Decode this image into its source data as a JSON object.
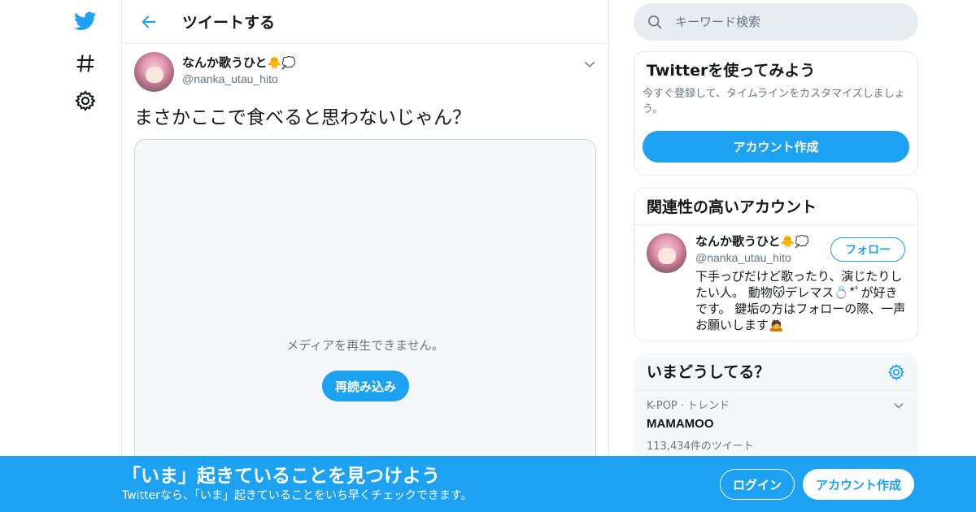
{
  "nav": {
    "icons": [
      "twitter-bird-icon",
      "hashtag-icon",
      "gear-icon"
    ]
  },
  "header": {
    "title": "ツイートする"
  },
  "tweet": {
    "author_name": "なんか歌うひと",
    "author_emoji": "🐥💭",
    "author_handle": "@nanka_utau_hito",
    "text": "まさかここで食べると思わないじゃん？",
    "media_message": "メディアを再生できません。",
    "reload_label": "再読み込み"
  },
  "search": {
    "placeholder": "キーワード検索"
  },
  "signup_card": {
    "title": "Twitterを使ってみよう",
    "description": "今すぐ登録して、タイムラインをカスタマイズしましょう。",
    "button_label": "アカウント作成"
  },
  "related_card": {
    "title": "関連性の高いアカウント",
    "name": "なんか歌うひと",
    "emoji": "🐥💭",
    "handle": "@nanka_utau_hito",
    "bio": "下手っぴだけど歌ったり、演じたりしたい人。 動物😽デレマス💍*ﾟが好きです。 鍵垢の方はフォローの際、一声お願いします🙇",
    "follow_label": "フォロー"
  },
  "trends_card": {
    "title": "いまどうしてる？",
    "trend_meta": "K-POP · トレンド",
    "trend_name": "MAMAMOO",
    "trend_count": "113,434件のツイート"
  },
  "banner": {
    "title": "「いま」起きていることを見つけよう",
    "subtitle": "Twitterなら、「いま」起きていることをいち早くチェックできます。",
    "login_label": "ログイン",
    "signup_label": "アカウント作成"
  },
  "colors": {
    "accent": "#1da1f2",
    "text": "#14171a",
    "secondary": "#657786",
    "border": "#e6ecf0"
  }
}
